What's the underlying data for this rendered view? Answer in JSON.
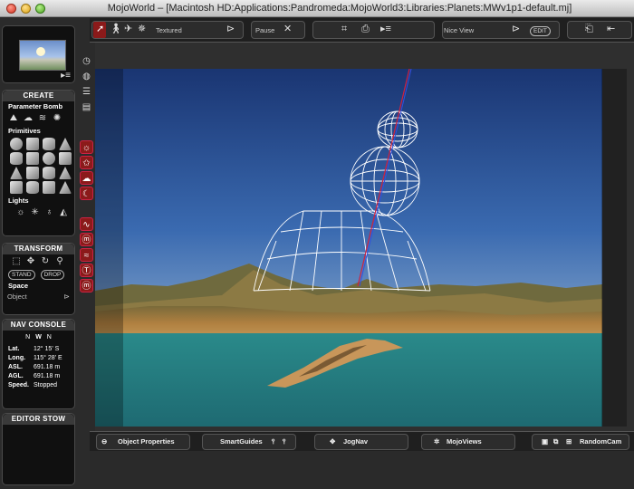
{
  "window": {
    "title": "MojoWorld – [Macintosh HD:Applications:Pandromeda:MojoWorld3:Libraries:Planets:MWv1p1-default.mj]"
  },
  "left_panel": {
    "create": {
      "header": "CREATE",
      "parameter_bomb_label": "Parameter Bomb",
      "primitives_label": "Primitives",
      "lights_label": "Lights"
    },
    "transform": {
      "header": "TRANSFORM",
      "stand_label": "STAND",
      "drop_label": "DROP",
      "space_label": "Space",
      "space_value": "Object"
    },
    "nav_console": {
      "header": "NAV CONSOLE",
      "compass": [
        "N",
        "W",
        "N"
      ],
      "rows": [
        {
          "key": "Lat.",
          "value": "12° 15' S"
        },
        {
          "key": "Long.",
          "value": "115° 28' E"
        },
        {
          "key": "ASL.",
          "value": "691.18 m"
        },
        {
          "key": "AGL.",
          "value": "691.18 m"
        },
        {
          "key": "Speed.",
          "value": "Stopped"
        }
      ]
    },
    "editor_stow": {
      "header": "EDITOR STOW"
    }
  },
  "top_toolbar": {
    "render_mode": "Textured",
    "pause_label": "Pause",
    "view_mode": "Nice View",
    "edit_label": "EDIT"
  },
  "bottom_toolbar": {
    "tabs": [
      {
        "label": "Object Properties"
      },
      {
        "label": "SmartGuides"
      },
      {
        "label": "JogNav"
      },
      {
        "label": "MojoViews"
      },
      {
        "label": "RandomCam"
      }
    ]
  },
  "colors": {
    "accent_red": "#8b1a1a",
    "sky_top": "#1c3a7a",
    "sky_horizon": "#9cb8d4",
    "sea": "#2a8080",
    "wireframe": "#ffffff"
  }
}
